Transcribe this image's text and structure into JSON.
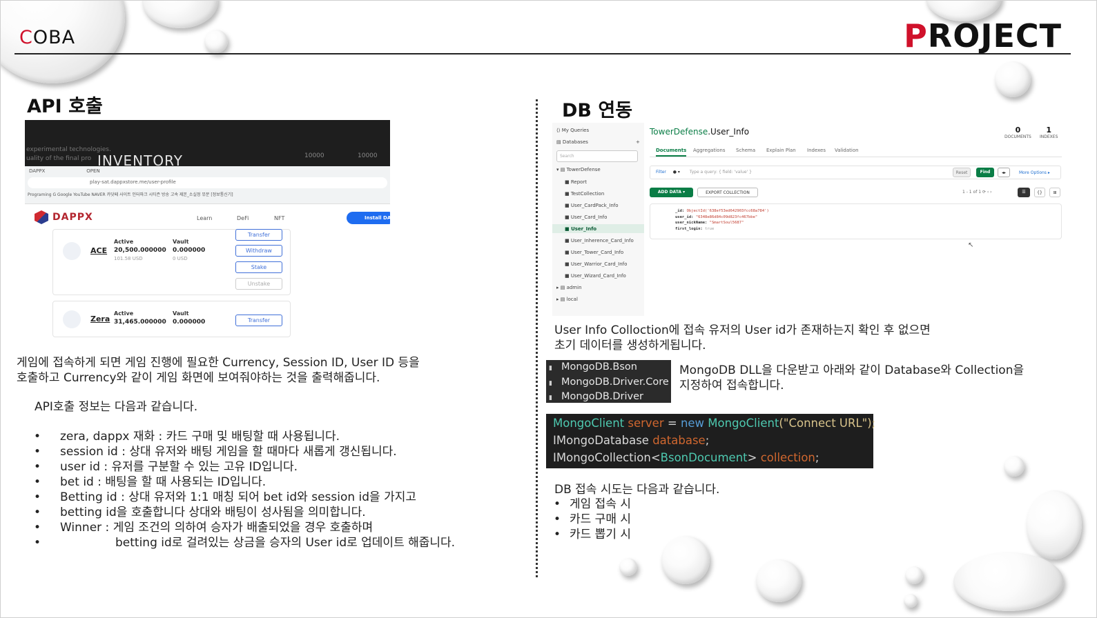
{
  "header": {
    "left_logo_first": "C",
    "left_logo_rest": "OBA",
    "right_logo_first": "P",
    "right_logo_rest": "ROJECT",
    "accent_color": "#d0112b"
  },
  "left": {
    "title": "API 호출",
    "description_1": "게임에 접속하게 되면 게임 진행에 필요한 Currency, Session ID, User ID 등을",
    "description_2": "호출하고 Currency와 같이 게임 화면에 보여줘야하는 것을 출력해줍니다.",
    "info_heading": "API호출 정보는 다음과 같습니다.",
    "bullets": [
      "zera, dappx 재화 : 카드 구매 및 배팅할 때 사용됩니다.",
      "session id : 상대 유저와 배팅 게임을 할 때마다 새롭게 갱신됩니다.",
      "user id : 유저를 구분할 수 있는 고유 ID입니다.",
      "bet id : 배팅을 할 때 사용되는 ID입니다.",
      "Betting id : 상대 유저와 1:1 매칭 되어 bet id와 session id을 가지고",
      "Winner : 게임 조건의 의하여 승자가 배출되었을 경우 호출하며"
    ],
    "bullet_5_cont": "betting id을 호출합니다 상대와 배팅이 성사됨을 의미합니다.",
    "bullet_6_cont": "betting id로 걸려있는 상금을 승자의 User id로 업데이트 해줍니다.",
    "screenshot": {
      "hero_lines": [
        "experimental technologies.",
        "uality of the final pro"
      ],
      "hero_title": "INVENTORY",
      "hero_nums": [
        "10000",
        "10000"
      ],
      "tabs": [
        "DAPPX",
        "OPEN"
      ],
      "url": "play-sat.dappxstore.me/user-profile",
      "bookmarks": "Programing   G Google   YouTube   NAVER   카닷페 사이트   인터파크 시티즌   방송   고속   제본_소실정   뮤분   [정보통신기]",
      "brand": "DAPPX",
      "nav": [
        "Learn",
        "DeFi",
        "NFT"
      ],
      "install": "Install DA",
      "coins": [
        {
          "symbol": "ACE",
          "active_label": "Active",
          "active": "20,500.000000",
          "active_usd": "101.58 USD",
          "vault_label": "Vault",
          "vault": "0.000000",
          "vault_usd": "0 USD",
          "buttons": [
            "Transfer",
            "Withdraw",
            "Stake",
            "Unstake"
          ]
        },
        {
          "symbol": "Zera",
          "active_label": "Active",
          "active": "31,465.000000",
          "vault_label": "Vault",
          "vault": "0.000000",
          "buttons": [
            "Transfer"
          ]
        }
      ]
    }
  },
  "right": {
    "title": "DB 연동",
    "desc_1": "User Info Colloction에 접속 유저의 User id가 존재하는지 확인 후 없으면",
    "desc_2": "초기 데이터를 생성하게됩니다.",
    "dll_items": [
      "MongoDB.Bson",
      "MongoDB.Driver.Core",
      "MongoDB.Driver"
    ],
    "dll_desc_1": "MongoDB DLL을 다운받고 아래와 같이 Database와 Collection을",
    "dll_desc_2": "지정하여 접속합니다.",
    "code": {
      "l1_type": "MongoClient",
      "l1_var": "server",
      "l1_eq": " = ",
      "l1_kw": "new",
      "l1_type2": "MongoClient",
      "l1_str": "(\"Connect URL\");",
      "l2_iface": "IMongoDatabase",
      "l2_var": "database",
      "l2_end": ";",
      "l3_iface": "IMongoCollection",
      "l3_lt": "<",
      "l3_type": "BsonDocument",
      "l3_gt": ">",
      "l3_var": "collection",
      "l3_end": ";"
    },
    "try_heading": "DB 접속 시도는 다음과 같습니다.",
    "try_items": [
      "게임 접속 시",
      "카드 구매 시",
      "카드 뽑기 시"
    ],
    "screenshot": {
      "sidebar": [
        "My Queries",
        "Databases",
        "Search",
        "TowerDefense",
        "Report",
        "TestCollection",
        "User_CardPack_Info",
        "User_Card_Info",
        "User_Info",
        "User_Inherence_Card_Info",
        "User_Tower_Card_Info",
        "User_Warrior_Card_Info",
        "User_Wizard_Card_Info",
        "admin",
        "local"
      ],
      "db": "TowerDefense",
      "collection": ".User_Info",
      "documents_count": "0",
      "documents_label": "DOCUMENTS",
      "indexes_count": "1",
      "indexes_label": "INDEXES",
      "tabs": [
        "Documents",
        "Aggregations",
        "Schema",
        "Explain Plan",
        "Indexes",
        "Validation"
      ],
      "filter": "Filter",
      "query_hint": "Type a query: { field: 'value' }",
      "reset": "Reset",
      "find": "Find",
      "more": "More Options ▸",
      "add_data": "ADD DATA ▾",
      "export": "EXPORT COLLECTION",
      "paging": "1 - 1 of 1",
      "doc_fields": [
        {
          "key": "_id:",
          "value": "ObjectId('638ef53ed642903fcc68a784')"
        },
        {
          "key": "user_id:",
          "value": "\"6348e86d84c09d823fc467bbe\""
        },
        {
          "key": "user_nickName:",
          "value": "\"SmartSoul5687\""
        },
        {
          "key": "first_login:",
          "value": "true"
        }
      ]
    }
  }
}
